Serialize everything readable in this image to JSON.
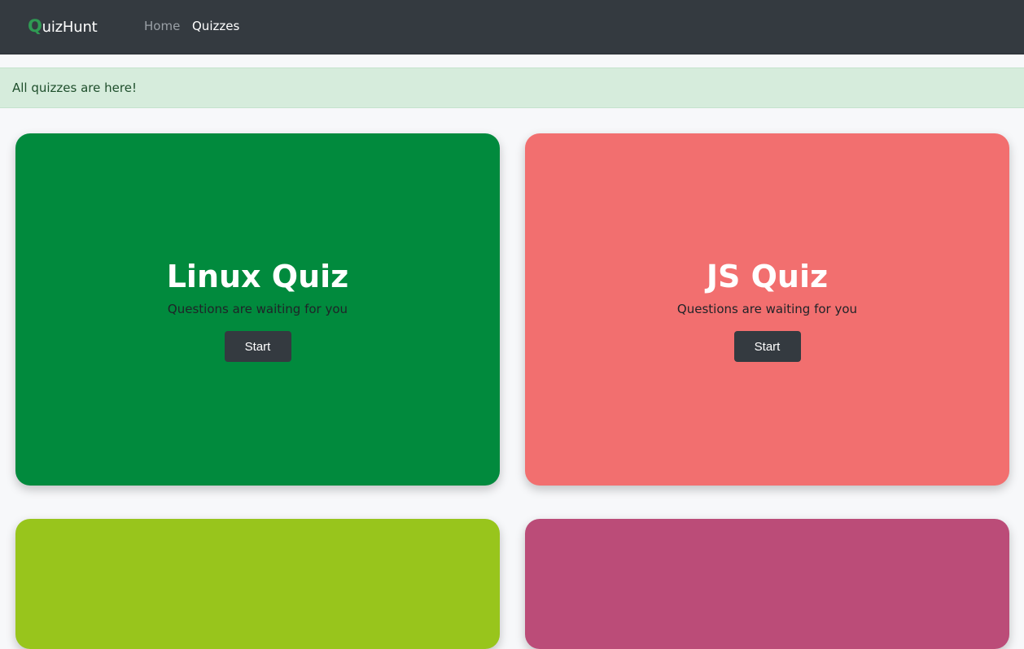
{
  "navbar": {
    "brand_first": "Q",
    "brand_rest": "uizHunt",
    "links": [
      {
        "label": "Home"
      },
      {
        "label": "Quizzes"
      }
    ]
  },
  "alert": {
    "text": "All quizzes are here!"
  },
  "quizzes": [
    {
      "title": "Linux Quiz",
      "subtitle": "Questions are waiting for you",
      "button": "Start",
      "color": "#018a3d"
    },
    {
      "title": "JS Quiz",
      "subtitle": "Questions are waiting for you",
      "button": "Start",
      "color": "#f26f6f"
    },
    {
      "title": "",
      "subtitle": "",
      "button": "",
      "color": "#98c51c"
    },
    {
      "title": "",
      "subtitle": "",
      "button": "",
      "color": "#bb4c78"
    }
  ],
  "colors": {
    "navbar_bg": "#343a40",
    "brand_accent": "#2f9a53",
    "alert_bg": "#d6ecdc",
    "button_bg": "#343a40"
  }
}
